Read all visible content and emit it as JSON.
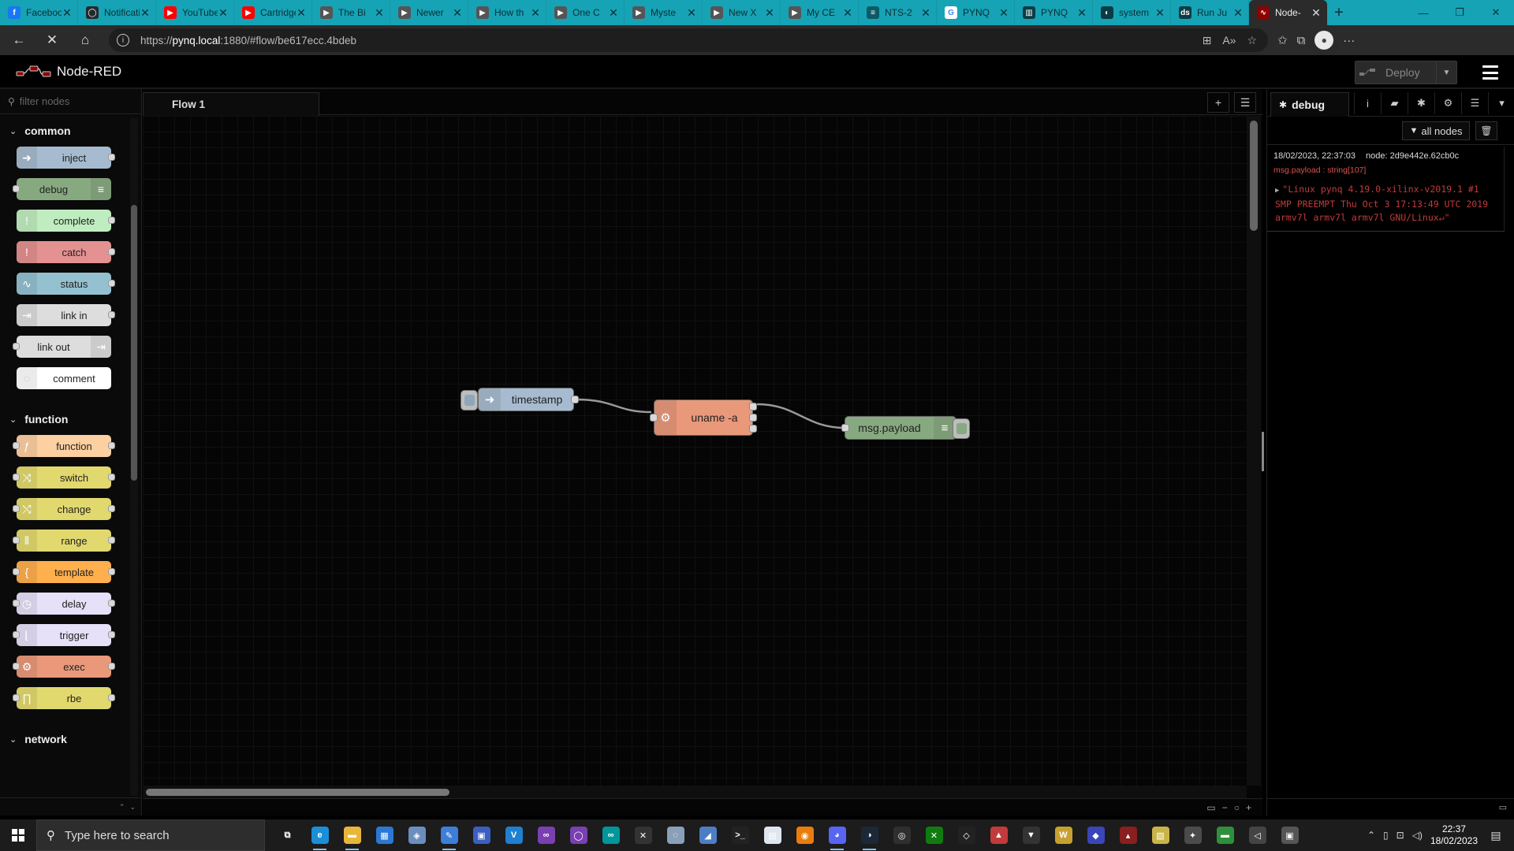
{
  "browser": {
    "tabs": [
      {
        "title": "Facebook",
        "icon": "facebook-icon",
        "color": "#1877f2",
        "glyph": "f"
      },
      {
        "title": "Notifications",
        "icon": "github-icon",
        "color": "#24292e",
        "glyph": "◯"
      },
      {
        "title": "YouTube",
        "icon": "youtube-icon",
        "color": "#ff0000",
        "glyph": "▶"
      },
      {
        "title": "Cartridge",
        "icon": "youtube-icon",
        "color": "#ff0000",
        "glyph": "▶"
      },
      {
        "title": "The Bi",
        "icon": "video-icon",
        "color": "#555555",
        "glyph": "▶"
      },
      {
        "title": "Newer",
        "icon": "video-icon",
        "color": "#555555",
        "glyph": "▶"
      },
      {
        "title": "How th",
        "icon": "video-icon",
        "color": "#555555",
        "glyph": "▶"
      },
      {
        "title": "One C",
        "icon": "video-icon",
        "color": "#555555",
        "glyph": "▶"
      },
      {
        "title": "Myste",
        "icon": "video-icon",
        "color": "#555555",
        "glyph": "▶"
      },
      {
        "title": "New X",
        "icon": "video-icon",
        "color": "#555555",
        "glyph": "▶"
      },
      {
        "title": "My CE",
        "icon": "video-icon",
        "color": "#555555",
        "glyph": "▶"
      },
      {
        "title": "NTS-2",
        "icon": "site-icon",
        "color": "#0a5b66",
        "glyph": "≡"
      },
      {
        "title": "PYNQ",
        "icon": "google-icon",
        "color": "#ffffff",
        "glyph": "G"
      },
      {
        "title": "PYNQ",
        "icon": "book-icon",
        "color": "#0b3b44",
        "glyph": "▥"
      },
      {
        "title": "system",
        "icon": "site-icon",
        "color": "#0b3b44",
        "glyph": "◐"
      },
      {
        "title": "Run Ju",
        "icon": "site-icon",
        "color": "#0b3b44",
        "glyph": "ds"
      },
      {
        "title": "Node-",
        "icon": "node-red-icon",
        "color": "#8f0000",
        "glyph": "∿"
      }
    ],
    "active_tab_index": 16,
    "url_prefix": "https://",
    "url_host": "pynq.local",
    "url_rest": ":1880/#flow/be617ecc.4bdeb"
  },
  "app": {
    "title": "Node-RED",
    "deploy_label": "Deploy"
  },
  "palette": {
    "search_placeholder": "filter nodes",
    "categories": [
      {
        "name": "common",
        "nodes": [
          {
            "label": "inject",
            "color": "#a6bbcf",
            "icon": "arrow-right-icon",
            "glyph": "➜",
            "ports": "out",
            "icon_side": "left"
          },
          {
            "label": "debug",
            "color": "#87a980",
            "icon": "list-icon",
            "glyph": "≡",
            "ports": "in",
            "icon_side": "right"
          },
          {
            "label": "complete",
            "color": "#c0edc0",
            "icon": "exclamation-icon",
            "glyph": "!",
            "ports": "out",
            "icon_side": "left"
          },
          {
            "label": "catch",
            "color": "#e49191",
            "icon": "exclamation-icon",
            "glyph": "!",
            "ports": "out",
            "icon_side": "left"
          },
          {
            "label": "status",
            "color": "#94c1d0",
            "icon": "pulse-icon",
            "glyph": "∿",
            "ports": "out",
            "icon_side": "left"
          },
          {
            "label": "link in",
            "color": "#dddddd",
            "icon": "link-icon",
            "glyph": "⇥",
            "ports": "out",
            "icon_side": "left"
          },
          {
            "label": "link out",
            "color": "#dddddd",
            "icon": "link-icon",
            "glyph": "⇥",
            "ports": "in",
            "icon_side": "right"
          },
          {
            "label": "comment",
            "color": "#ffffff",
            "icon": "comment-icon",
            "glyph": "◌",
            "ports": "none",
            "icon_side": "left"
          }
        ]
      },
      {
        "name": "function",
        "nodes": [
          {
            "label": "function",
            "color": "#fdd0a2",
            "icon": "function-icon",
            "glyph": "ƒ",
            "ports": "both",
            "icon_side": "left"
          },
          {
            "label": "switch",
            "color": "#e2d96e",
            "icon": "switch-icon",
            "glyph": "⤨",
            "ports": "both",
            "icon_side": "left"
          },
          {
            "label": "change",
            "color": "#e2d96e",
            "icon": "shuffle-icon",
            "glyph": "⤭",
            "ports": "both",
            "icon_side": "left"
          },
          {
            "label": "range",
            "color": "#e2d96e",
            "icon": "range-icon",
            "glyph": "⦀",
            "ports": "both",
            "icon_side": "left"
          },
          {
            "label": "template",
            "color": "#ffaf4c",
            "icon": "template-icon",
            "glyph": "{",
            "ports": "both",
            "icon_side": "left"
          },
          {
            "label": "delay",
            "color": "#e6e0f8",
            "icon": "timer-icon",
            "glyph": "◷",
            "ports": "both",
            "icon_side": "left"
          },
          {
            "label": "trigger",
            "color": "#e6e0f8",
            "icon": "trigger-icon",
            "glyph": "⌊",
            "ports": "both",
            "icon_side": "left"
          },
          {
            "label": "exec",
            "color": "#e9987a",
            "icon": "gear-icon",
            "glyph": "⚙",
            "ports": "both",
            "icon_side": "left"
          },
          {
            "label": "rbe",
            "color": "#e2d96e",
            "icon": "rbe-icon",
            "glyph": "∏",
            "ports": "both",
            "icon_side": "left"
          }
        ]
      },
      {
        "name": "network",
        "nodes": []
      }
    ]
  },
  "workspace": {
    "flow_tab": "Flow 1",
    "nodes": {
      "inject": {
        "label": "timestamp",
        "color": "#a6bbcf",
        "button_color": "#8ea6ba"
      },
      "exec": {
        "label": "uname -a",
        "color": "#e9987a"
      },
      "debug": {
        "label": "msg.payload",
        "color": "#87a980",
        "button_color": "#87a980"
      }
    }
  },
  "sidebar": {
    "tab_label": "debug",
    "filter_label": "all nodes",
    "message": {
      "timestamp": "18/02/2023, 22:37:03",
      "node": "node: 2d9e442e.62cb0c",
      "topic": "msg.payload : string[107]",
      "payload": "\"Linux pynq 4.19.0-xilinx-v2019.1 #1 SMP PREEMPT Thu Oct 3 17:13:49 UTC 2019 armv7l armv7l armv7l GNU/Linux↵\""
    }
  },
  "taskbar": {
    "search_placeholder": "Type here to search",
    "time": "22:37",
    "date": "18/02/2023",
    "apps": [
      {
        "name": "task-view-icon",
        "color": "transparent",
        "glyph": "⧉"
      },
      {
        "name": "edge-icon",
        "color": "#1a8fd8",
        "glyph": "e",
        "running": true
      },
      {
        "name": "file-explorer-icon",
        "color": "#e8b73a",
        "glyph": "▬",
        "running": true
      },
      {
        "name": "store-icon",
        "color": "#2b78d4",
        "glyph": "▦"
      },
      {
        "name": "app-icon",
        "color": "#6c8ebf",
        "glyph": "◈"
      },
      {
        "name": "paint-icon",
        "color": "#3d7fd8",
        "glyph": "✎",
        "running": true
      },
      {
        "name": "app-icon",
        "color": "#3b5fc0",
        "glyph": "▣"
      },
      {
        "name": "vscode-icon",
        "color": "#1f7fd0",
        "glyph": "V"
      },
      {
        "name": "visual-studio-icon",
        "color": "#7a3fb0",
        "glyph": "∞"
      },
      {
        "name": "github-desktop-icon",
        "color": "#7a3fb0",
        "glyph": "◯"
      },
      {
        "name": "arduino-icon",
        "color": "#00979c",
        "glyph": "∞"
      },
      {
        "name": "xilinx-icon",
        "color": "#333333",
        "glyph": "✕"
      },
      {
        "name": "app-icon",
        "color": "#8aa0b8",
        "glyph": "◌"
      },
      {
        "name": "app-icon",
        "color": "#4d7ec4",
        "glyph": "◢"
      },
      {
        "name": "terminal-icon",
        "color": "#222222",
        "glyph": ">_"
      },
      {
        "name": "document-icon",
        "color": "#dfe6ef",
        "glyph": "▤"
      },
      {
        "name": "blender-icon",
        "color": "#e87d0d",
        "glyph": "◉"
      },
      {
        "name": "discord-icon",
        "color": "#5865f2",
        "glyph": "◕",
        "running": true
      },
      {
        "name": "steam-icon",
        "color": "#1b2838",
        "glyph": "◑",
        "running": true
      },
      {
        "name": "obs-icon",
        "color": "#2f2f2f",
        "glyph": "◎"
      },
      {
        "name": "xbox-icon",
        "color": "#107c10",
        "glyph": "✕"
      },
      {
        "name": "unity-icon",
        "color": "#222222",
        "glyph": "◇"
      },
      {
        "name": "app-icon",
        "color": "#c23b3b",
        "glyph": "▲"
      },
      {
        "name": "app-icon",
        "color": "#333333",
        "glyph": "▼"
      },
      {
        "name": "winamp-icon",
        "color": "#c8a030",
        "glyph": "W"
      },
      {
        "name": "app-icon",
        "color": "#3a46b8",
        "glyph": "◆"
      },
      {
        "name": "app-icon",
        "color": "#8a1f1f",
        "glyph": "▴"
      },
      {
        "name": "app-icon",
        "color": "#c9b44a",
        "glyph": "▧"
      },
      {
        "name": "app-icon",
        "color": "#4b4b4b",
        "glyph": "✦"
      },
      {
        "name": "app-icon",
        "color": "#2f8f3a",
        "glyph": "▬"
      },
      {
        "name": "unity-hub-icon",
        "color": "#444444",
        "glyph": "◁"
      },
      {
        "name": "app-icon",
        "color": "#555555",
        "glyph": "▣"
      }
    ]
  }
}
